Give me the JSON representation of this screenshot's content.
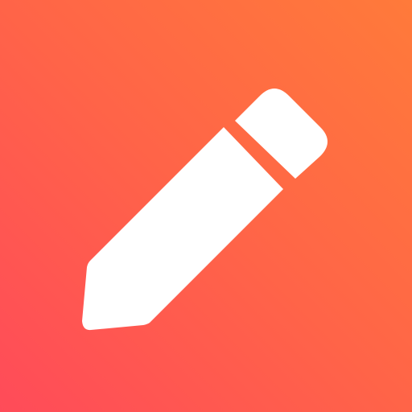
{
  "icon": {
    "name": "pencil-icon",
    "glyph_color": "#FFFFFF"
  },
  "background": {
    "gradient_colors": [
      "#FF4B59",
      "#FF6448",
      "#FF7A3A"
    ]
  }
}
